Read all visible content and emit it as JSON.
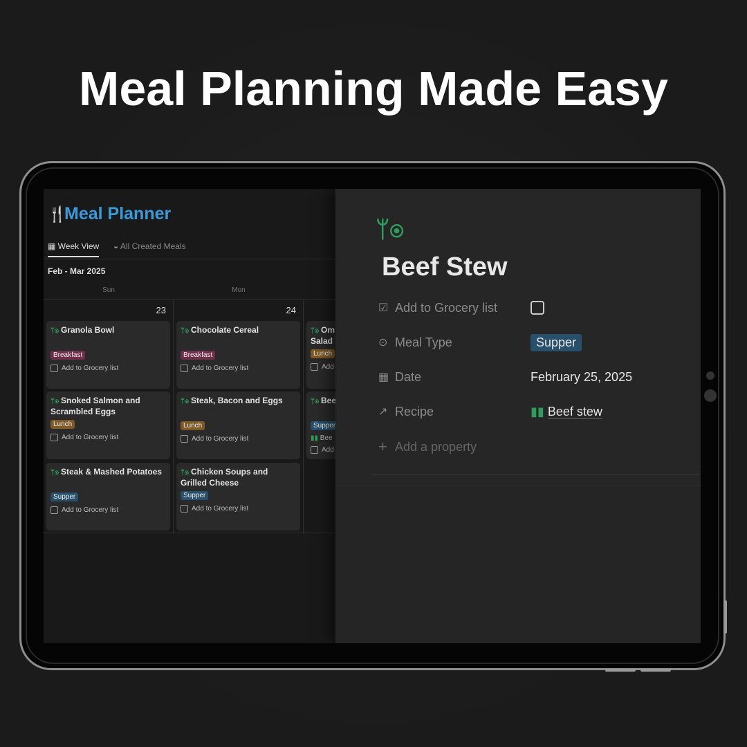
{
  "headline": "Meal Planning Made Easy",
  "app": {
    "title": "Meal Planner",
    "title_icon": "fork-knife-icon",
    "tabs": [
      {
        "label": "Week View",
        "icon": "calendar-icon",
        "active": true
      },
      {
        "label": "All Created Meals",
        "icon": "bowl-icon",
        "active": false
      }
    ],
    "range": "Feb - Mar 2025",
    "days": [
      {
        "dow": "Sun",
        "date": "23",
        "meals": [
          {
            "name": "Granola Bowl",
            "type": "Breakfast",
            "grocery": "Add to Grocery list"
          },
          {
            "name": "Snoked Salmon and Scrambled Eggs",
            "type": "Lunch",
            "grocery": "Add to Grocery list"
          },
          {
            "name": "Steak & Mashed Potatoes",
            "type": "Supper",
            "grocery": "Add to Grocery list"
          }
        ]
      },
      {
        "dow": "Mon",
        "date": "24",
        "meals": [
          {
            "name": "Chocolate Cereal",
            "type": "Breakfast",
            "grocery": "Add to Grocery list"
          },
          {
            "name": "Steak, Bacon and Eggs",
            "type": "Lunch",
            "grocery": "Add to Grocery list"
          },
          {
            "name": "Chicken Soups and Grilled Cheese",
            "type": "Supper",
            "grocery": "Add to Grocery list"
          }
        ]
      },
      {
        "meals": [
          {
            "name": "Om",
            "line2": "Salad",
            "type": "Lunch",
            "grocery": "Add"
          },
          {
            "name": "Bee",
            "type": "Supper",
            "recipe": "Bee",
            "grocery": "Add"
          }
        ]
      }
    ]
  },
  "detail": {
    "icon": "fork-plate-icon",
    "title": "Beef Stew",
    "properties": [
      {
        "label": "Add to Grocery list",
        "icon": "checkbox-icon",
        "value": "",
        "checked": false
      },
      {
        "label": "Meal Type",
        "icon": "select-icon",
        "value": "Supper"
      },
      {
        "label": "Date",
        "icon": "calendar-icon",
        "value": "February 25, 2025"
      },
      {
        "label": "Recipe",
        "icon": "relation-arrow-icon",
        "value": "Beef stew"
      }
    ],
    "add_property": "Add a property"
  },
  "colors": {
    "accent": "#3a9bd8",
    "green": "#2e9d5c",
    "breakfast": "#6e2f48",
    "lunch": "#7d5a26",
    "supper": "#28506b"
  }
}
